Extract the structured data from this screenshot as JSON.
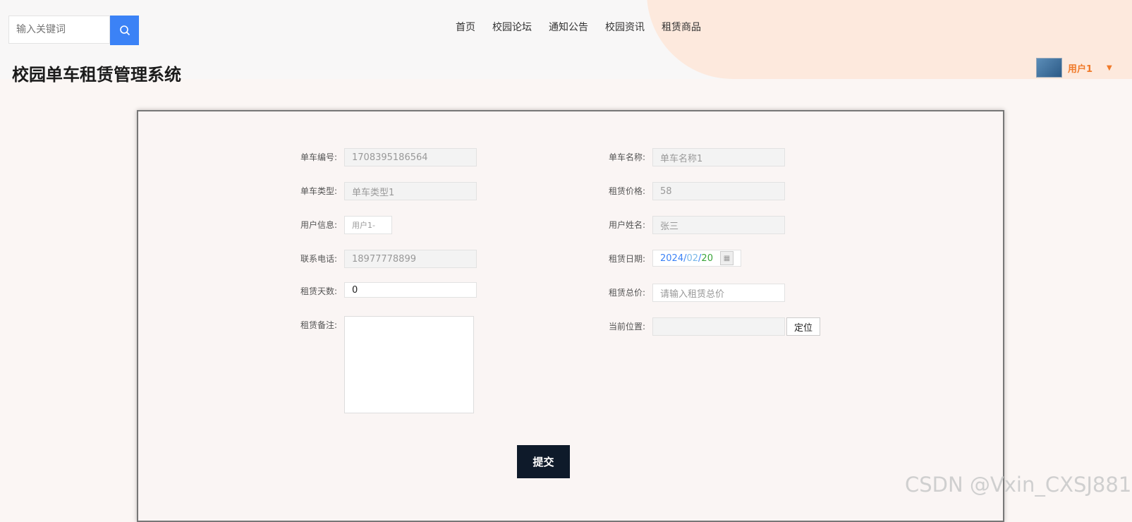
{
  "search": {
    "placeholder": "输入关键词"
  },
  "nav": [
    "首页",
    "校园论坛",
    "通知公告",
    "校园资讯",
    "租赁商品"
  ],
  "site_title": "校园单车租赁管理系统",
  "user": {
    "name": "用户1"
  },
  "form": {
    "bike_no": {
      "label": "单车编号:",
      "value": "1708395186564"
    },
    "bike_name": {
      "label": "单车名称:",
      "value": "单车名称1"
    },
    "bike_type": {
      "label": "单车类型:",
      "value": "单车类型1"
    },
    "rent_price": {
      "label": "租赁价格:",
      "value": "58"
    },
    "user_info": {
      "label": "用户信息:",
      "value": "用户1-"
    },
    "user_name": {
      "label": "用户姓名:",
      "value": "张三"
    },
    "phone": {
      "label": "联系电话:",
      "value": "18977778899"
    },
    "rent_date": {
      "label": "租赁日期:",
      "year": "2024",
      "month": "02",
      "day": "20"
    },
    "rent_days": {
      "label": "租赁天数:",
      "value": "0"
    },
    "total_price": {
      "label": "租赁总价:",
      "placeholder": "请输入租赁总价"
    },
    "remark": {
      "label": "租赁备注:"
    },
    "location": {
      "label": "当前位置:",
      "button": "定位"
    }
  },
  "submit_label": "提交",
  "watermark": "CSDN @Vxin_CXSJ881",
  "colors": {
    "accent": "#3b82f6",
    "user": "#f07a2a",
    "submit": "#0e1a2a"
  }
}
